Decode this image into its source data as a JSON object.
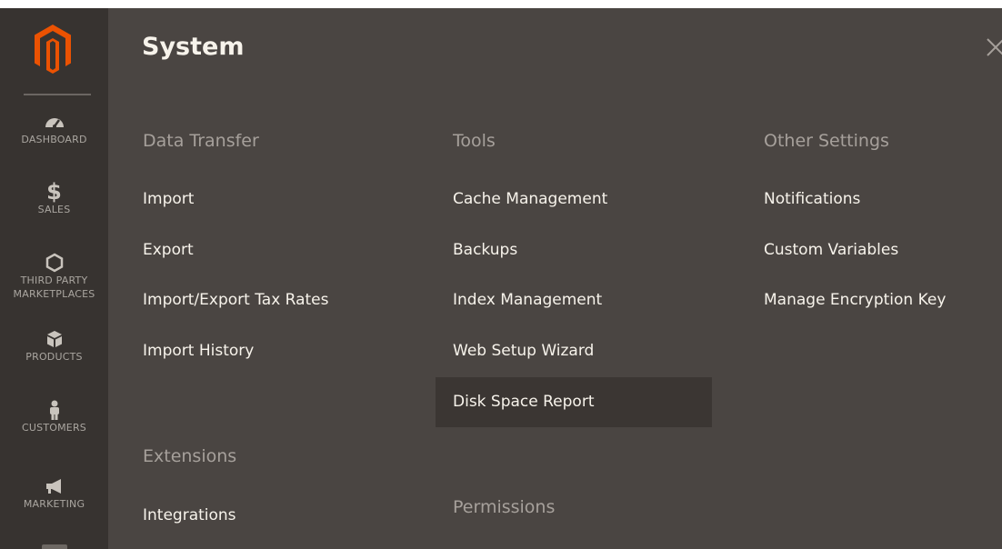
{
  "sidebar": {
    "items": [
      {
        "label": "DASHBOARD",
        "icon": "dashboard-icon"
      },
      {
        "label": "$",
        "icon": "dollar-icon"
      },
      {
        "label": "SALES"
      },
      {
        "label": "THIRD PARTY",
        "icon": "hexagon-icon"
      },
      {
        "label": "MARKETPLACES"
      },
      {
        "label": "PRODUCTS",
        "icon": "cube-icon"
      },
      {
        "label": "CUSTOMERS",
        "icon": "person-icon"
      },
      {
        "label": "MARKETING",
        "icon": "megaphone-icon"
      }
    ]
  },
  "panel": {
    "title": "System",
    "columns": [
      {
        "sections": [
          {
            "title": "Data Transfer",
            "links": [
              "Import",
              "Export",
              "Import/Export Tax Rates",
              "Import History"
            ]
          },
          {
            "title": "Extensions",
            "links": [
              "Integrations"
            ]
          }
        ]
      },
      {
        "sections": [
          {
            "title": "Tools",
            "links": [
              "Cache Management",
              "Backups",
              "Index Management",
              "Web Setup Wizard",
              "Disk Space Report"
            ]
          },
          {
            "title": "Permissions",
            "links": []
          }
        ]
      },
      {
        "sections": [
          {
            "title": "Other Settings",
            "links": [
              "Notifications",
              "Custom Variables",
              "Manage Encryption Key"
            ]
          }
        ]
      }
    ],
    "highlighted_link": "Disk Space Report"
  },
  "colors": {
    "sidebar_bg": "#373330",
    "panel_bg": "#4a4542",
    "highlight_bg": "#3b3633",
    "logo_orange": "#eb5202",
    "text_light": "#f7f3eb",
    "text_muted": "#a6a09b"
  }
}
